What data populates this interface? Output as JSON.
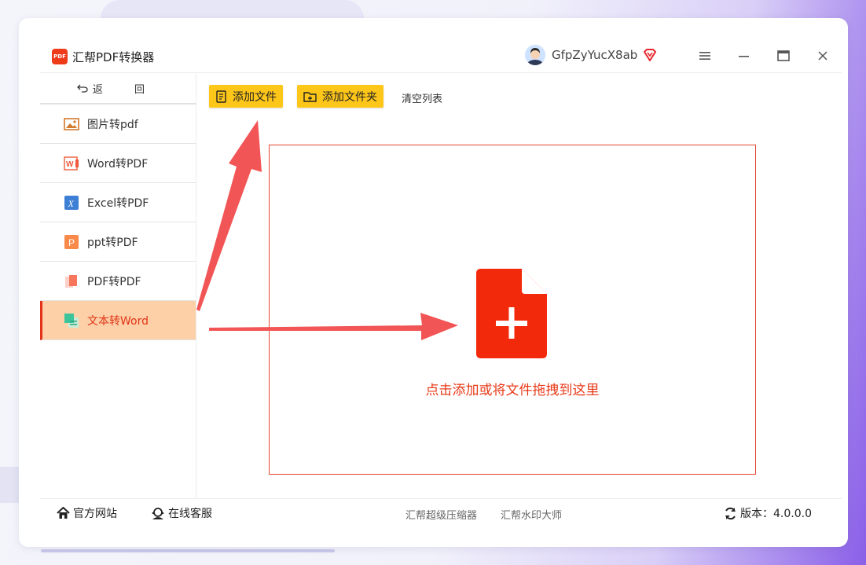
{
  "app": {
    "title": "汇帮PDF转换器",
    "logo_text": "PDF"
  },
  "user": {
    "name": "GfpZyYucX8ab"
  },
  "sidebar": {
    "back_label": "返 回",
    "items": [
      {
        "label": "图片转pdf",
        "icon": "image-icon"
      },
      {
        "label": "Word转PDF",
        "icon": "word-icon"
      },
      {
        "label": "Excel转PDF",
        "icon": "excel-icon"
      },
      {
        "label": "ppt转PDF",
        "icon": "ppt-icon"
      },
      {
        "label": "PDF转PDF",
        "icon": "pdf-icon"
      },
      {
        "label": "文本转Word",
        "icon": "text-icon",
        "active": true
      }
    ]
  },
  "toolbar": {
    "add_file": "添加文件",
    "add_folder": "添加文件夹",
    "clear_list": "清空列表"
  },
  "dropzone": {
    "text": "点击添加或将文件拖拽到这里"
  },
  "footer": {
    "website": "官方网站",
    "support": "在线客服",
    "link1": "汇帮超级压缩器",
    "link2": "汇帮水印大师",
    "version": "版本：4.0.0.0"
  },
  "colors": {
    "accent": "#e83a18",
    "button": "#ffc61a",
    "active_bg": "#fdd0a8",
    "arrow": "#f25555"
  }
}
